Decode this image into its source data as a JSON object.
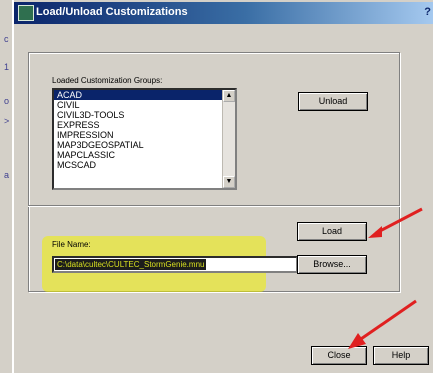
{
  "window": {
    "title": "Load/Unload Customizations",
    "help_glyph": "?"
  },
  "groups": {
    "label": "Loaded Customization Groups:",
    "items": [
      "ACAD",
      "CIVIL",
      "CIVIL3D-TOOLS",
      "EXPRESS",
      "IMPRESSION",
      "MAP3DGEOSPATIAL",
      "MAPCLASSIC",
      "MCSCAD"
    ],
    "selected": "ACAD"
  },
  "buttons": {
    "unload": "Unload",
    "load": "Load",
    "browse": "Browse...",
    "close": "Close",
    "help": "Help"
  },
  "file": {
    "label": "File Name:",
    "value": "C:\\data\\cultec\\CULTEC_StormGenie.mnu"
  },
  "annotation": {
    "highlight_color": "#f0f000",
    "arrow_color": "#e02020"
  }
}
